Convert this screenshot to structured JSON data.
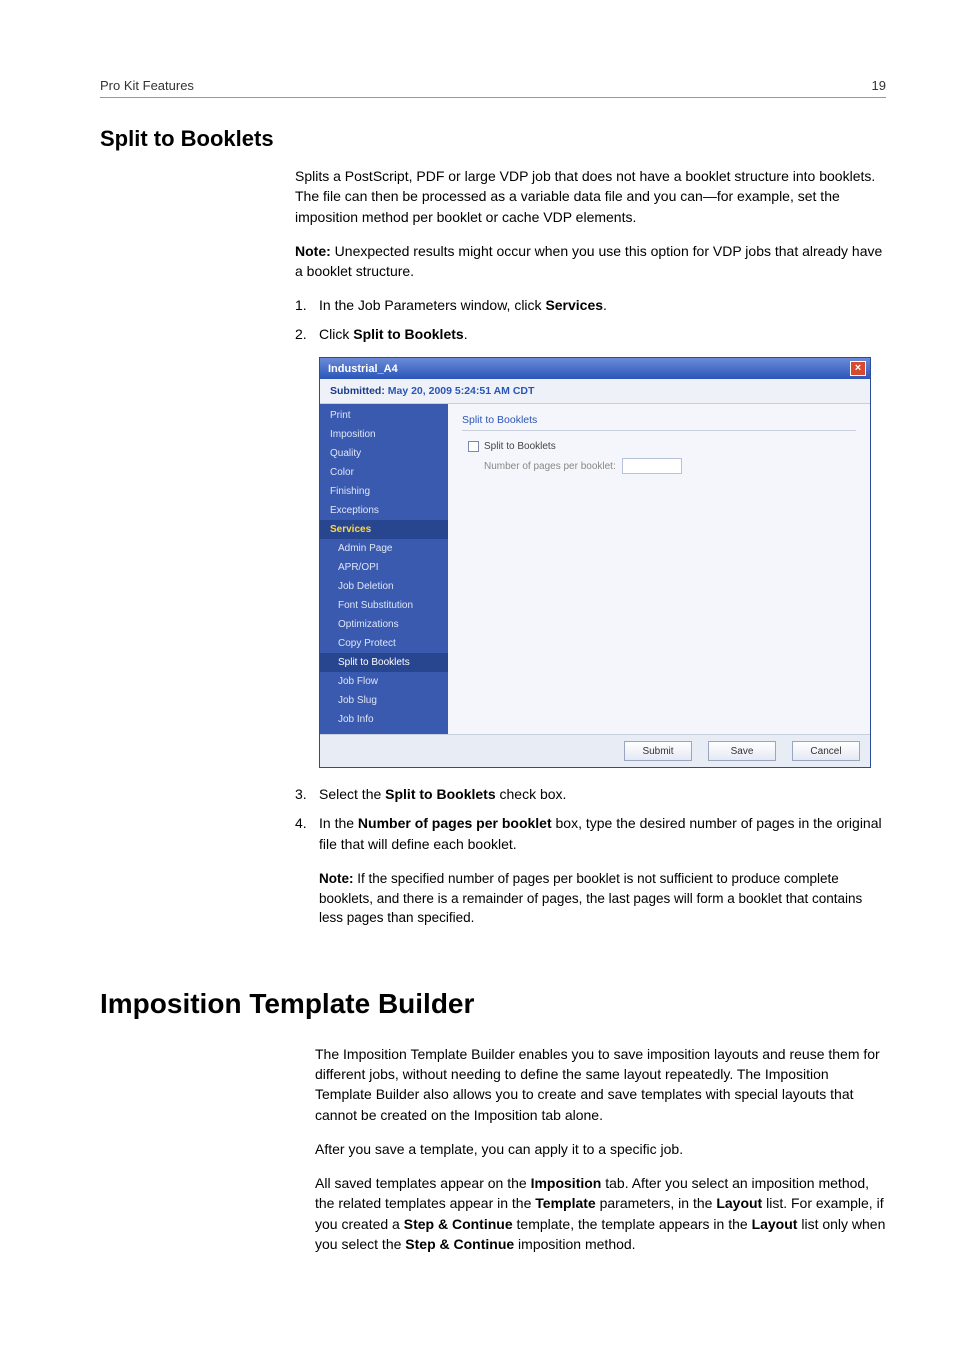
{
  "header": {
    "left": "Pro Kit Features",
    "right": "19"
  },
  "section1": {
    "title": "Split to Booklets",
    "intro": "Splits a PostScript, PDF or large VDP job that does not have a booklet structure into booklets. The file can then be processed as a variable data file and you can—for example, set the imposition method per booklet or cache VDP elements.",
    "note_label": "Note:",
    "note_text": "  Unexpected results might occur when you use this option for VDP jobs that already have a booklet structure.",
    "step1_pre": "In the Job Parameters window, click ",
    "step1_bold": "Services",
    "step1_post": ".",
    "step2_pre": "Click ",
    "step2_bold": "Split to Booklets",
    "step2_post": ".",
    "step3_pre": "Select the ",
    "step3_bold": "Split to Booklets",
    "step3_post": " check box.",
    "step4_pre": "In the ",
    "step4_bold": "Number of pages per booklet",
    "step4_post": " box, type the desired number of pages in the original file that will define each booklet.",
    "step4_note_label": "Note:",
    "step4_note_text": "  If the specified number of pages per booklet is not sufficient to produce complete booklets, and there is a remainder of pages, the last pages will form a booklet that contains less pages than specified."
  },
  "dialog": {
    "title": "Industrial_A4",
    "submitted_label": "Submitted:",
    "submitted_value": "  May 20, 2009 5:24:51 AM CDT",
    "sidebar": {
      "top": [
        "Print",
        "Imposition",
        "Quality",
        "Color",
        "Finishing",
        "Exceptions"
      ],
      "services_label": "Services",
      "subs": [
        "Admin Page",
        "APR/OPI",
        "Job Deletion",
        "Font Substitution",
        "Optimizations",
        "Copy Protect",
        "Split to Booklets",
        "Job Flow",
        "Job Slug",
        "Job Info"
      ]
    },
    "panel": {
      "title": "Split to Booklets",
      "checkbox_label": "Split to Booklets",
      "field_label": "Number of pages per booklet:"
    },
    "buttons": {
      "submit": "Submit",
      "save": "Save",
      "cancel": "Cancel"
    }
  },
  "section2": {
    "title": "Imposition Template Builder",
    "p1": "The Imposition Template Builder enables you to save imposition layouts and reuse them for different jobs, without needing to define the same layout repeatedly. The Imposition Template Builder also allows you to create and save templates with special layouts that cannot be created on the Imposition tab alone.",
    "p2": "After you save a template, you can apply it to a specific job.",
    "p3_1": "All saved templates appear on the ",
    "p3_b1": "Imposition",
    "p3_2": " tab. After you select an imposition method, the related templates appear in the ",
    "p3_b2": "Template",
    "p3_3": " parameters, in the ",
    "p3_b3": "Layout",
    "p3_4": " list. For example, if you created a ",
    "p3_b4": "Step & Continue",
    "p3_5": " template, the template appears in the ",
    "p3_b5": "Layout",
    "p3_6": " list only when you select the ",
    "p3_b6": "Step & Continue",
    "p3_7": " imposition method."
  }
}
